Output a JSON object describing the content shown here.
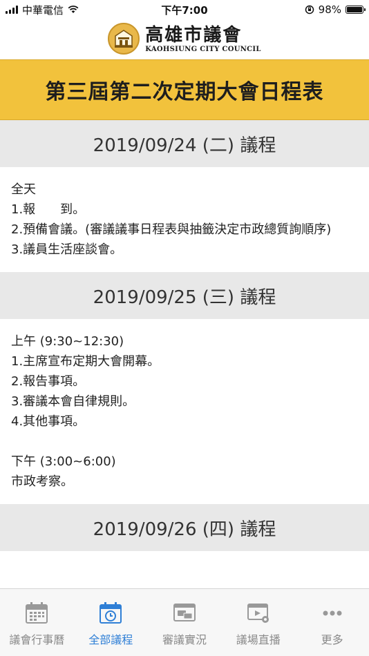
{
  "status_bar": {
    "carrier": "中華電信",
    "time": "下午7:00",
    "battery_percent": "98%",
    "battery_level": 0.98
  },
  "header": {
    "logo_cn": "高雄市議會",
    "logo_en": "KAOHSIUNG CITY COUNCIL"
  },
  "title": "第三屆第二次定期大會日程表",
  "days": [
    {
      "header": "2019/09/24 (二) 議程",
      "lines": [
        "全天",
        "1.報　　到。",
        "2.預備會議。(審議議事日程表與抽籤決定市政總質詢順序)",
        "3.議員生活座談會。"
      ]
    },
    {
      "header": "2019/09/25 (三) 議程",
      "lines": [
        "上午 (9:30~12:30)",
        "1.主席宣布定期大會開幕。",
        "2.報告事項。",
        "3.審議本會自律規則。",
        "4.其他事項。",
        "下午 (3:00~6:00)",
        "市政考察。"
      ]
    },
    {
      "header": "2019/09/26 (四) 議程"
    }
  ],
  "tabs": [
    {
      "label": "議會行事曆",
      "icon": "calendar-icon",
      "active": false
    },
    {
      "label": "全部議程",
      "icon": "schedule-clock-icon",
      "active": true
    },
    {
      "label": "審議實況",
      "icon": "chat-screen-icon",
      "active": false
    },
    {
      "label": "議場直播",
      "icon": "live-video-icon",
      "active": false
    },
    {
      "label": "更多",
      "icon": "more-dots-icon",
      "active": false
    }
  ],
  "colors": {
    "title_band": "#f2c23c",
    "day_header_bg": "#e8e8e8",
    "active_tab": "#2f7fd6",
    "inactive_tab": "#8a8a8a"
  }
}
